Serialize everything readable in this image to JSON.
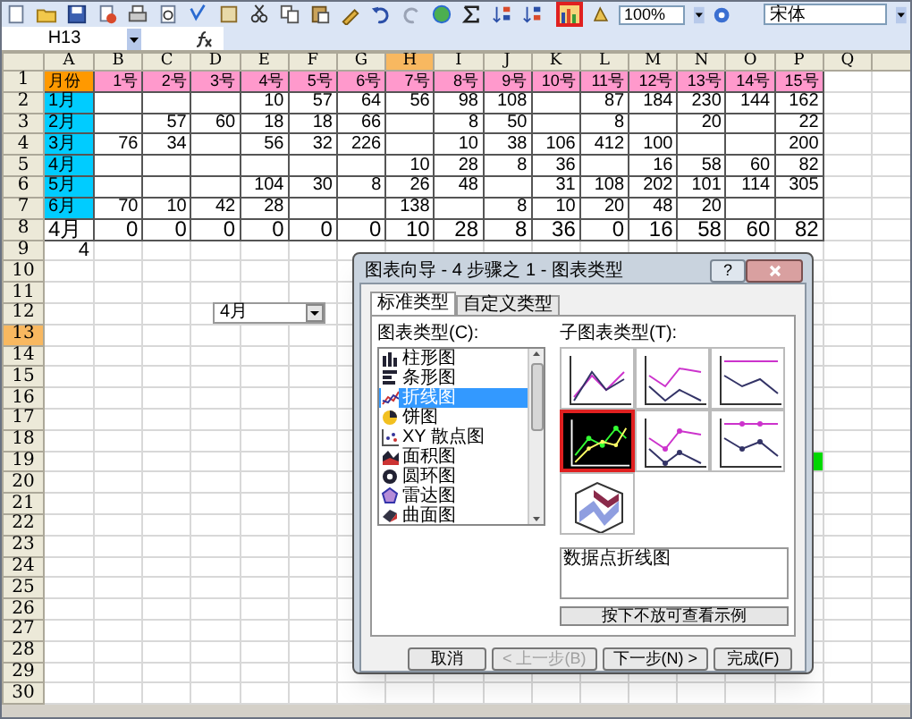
{
  "toolbar": {
    "chart_wizard": {
      "highlighted": true
    },
    "zoom": "100%",
    "font": "宋体"
  },
  "name_box": "H13",
  "sheet": {
    "columns": [
      {
        "label": "A",
        "selected": false
      },
      {
        "label": "B",
        "selected": false
      },
      {
        "label": "C",
        "selected": false
      },
      {
        "label": "D",
        "selected": false
      },
      {
        "label": "E",
        "selected": false
      },
      {
        "label": "F",
        "selected": false
      },
      {
        "label": "G",
        "selected": false
      },
      {
        "label": "H",
        "selected": true
      },
      {
        "label": "I",
        "selected": false
      },
      {
        "label": "J",
        "selected": false
      },
      {
        "label": "K",
        "selected": false
      },
      {
        "label": "L",
        "selected": false
      },
      {
        "label": "M",
        "selected": false
      },
      {
        "label": "N",
        "selected": false
      },
      {
        "label": "O",
        "selected": false
      },
      {
        "label": "P",
        "selected": false
      },
      {
        "label": "Q",
        "selected": false
      }
    ],
    "rows": [
      {
        "number": "1",
        "selected": false,
        "kind": "header",
        "cells": [
          {
            "text": "月份",
            "color": "#ff9900"
          },
          {
            "text": "1号",
            "color": "#ff99cc"
          },
          {
            "text": "2号",
            "color": "#ff99cc"
          },
          {
            "text": "3号",
            "color": "#ff99cc"
          },
          {
            "text": "4号",
            "color": "#ff99cc"
          },
          {
            "text": "5号",
            "color": "#ff99cc"
          },
          {
            "text": "6号",
            "color": "#ff99cc"
          },
          {
            "text": "7号",
            "color": "#ff99cc"
          },
          {
            "text": "8号",
            "color": "#ff99cc"
          },
          {
            "text": "9号",
            "color": "#ff99cc"
          },
          {
            "text": "10号",
            "color": "#ff99cc"
          },
          {
            "text": "11号",
            "color": "#ff99cc"
          },
          {
            "text": "12号",
            "color": "#ff99cc"
          },
          {
            "text": "13号",
            "color": "#ff99cc"
          },
          {
            "text": "14号",
            "color": "#ff99cc"
          },
          {
            "text": "15号",
            "color": "#ff99cc"
          }
        ]
      },
      {
        "number": "2",
        "selected": false,
        "kind": "data",
        "cells": [
          {
            "text": "1月",
            "color": "#00ccff"
          },
          null,
          null,
          null,
          "10",
          "57",
          "64",
          "56",
          "98",
          "108",
          null,
          "87",
          "184",
          "230",
          "144",
          "162"
        ]
      },
      {
        "number": "3",
        "selected": false,
        "kind": "data",
        "cells": [
          {
            "text": "2月",
            "color": "#00ccff"
          },
          null,
          "57",
          "60",
          "18",
          "18",
          "66",
          null,
          "8",
          "50",
          null,
          "8",
          null,
          "20",
          null,
          "22"
        ]
      },
      {
        "number": "4",
        "selected": false,
        "kind": "data",
        "cells": [
          {
            "text": "3月",
            "color": "#00ccff"
          },
          "76",
          "34",
          null,
          "56",
          "32",
          "226",
          null,
          "10",
          "38",
          "106",
          "412",
          "100",
          null,
          null,
          "200"
        ]
      },
      {
        "number": "5",
        "selected": false,
        "kind": "data",
        "cells": [
          {
            "text": "4月",
            "color": "#00ccff"
          },
          null,
          null,
          null,
          null,
          null,
          null,
          "10",
          "28",
          "8",
          "36",
          null,
          "16",
          "58",
          "60",
          "82"
        ]
      },
      {
        "number": "6",
        "selected": false,
        "kind": "data",
        "cells": [
          {
            "text": "5月",
            "color": "#00ccff"
          },
          null,
          null,
          null,
          "104",
          "30",
          "8",
          "26",
          "48",
          null,
          "31",
          "108",
          "202",
          "101",
          "114",
          "305"
        ]
      },
      {
        "number": "7",
        "selected": false,
        "kind": "data",
        "cells": [
          {
            "text": "6月",
            "color": "#00ccff"
          },
          "70",
          "10",
          "42",
          "28",
          null,
          null,
          "138",
          null,
          "8",
          "10",
          "20",
          "48",
          "20"
        ]
      },
      {
        "number": "8",
        "selected": false,
        "kind": "total",
        "cells": [
          "4月",
          "0",
          "0",
          "0",
          "0",
          "0",
          "0",
          "10",
          "28",
          "8",
          "36",
          "0",
          "16",
          "58",
          "60",
          "82"
        ]
      },
      {
        "number": "9",
        "selected": false,
        "kind": "value",
        "cells": [
          "4"
        ]
      },
      {
        "number": "10",
        "selected": false,
        "kind": "blank"
      },
      {
        "number": "11",
        "selected": false,
        "kind": "blank"
      },
      {
        "number": "12",
        "selected": false,
        "kind": "blank"
      },
      {
        "number": "13",
        "selected": true,
        "kind": "blank"
      },
      {
        "number": "14",
        "selected": false,
        "kind": "blank"
      },
      {
        "number": "15",
        "selected": false,
        "kind": "blank"
      },
      {
        "number": "16",
        "selected": false,
        "kind": "blank"
      },
      {
        "number": "17",
        "selected": false,
        "kind": "blank"
      },
      {
        "number": "18",
        "selected": false,
        "kind": "blank"
      },
      {
        "number": "19",
        "selected": false,
        "kind": "blank",
        "cells": [
          null,
          null,
          null,
          null,
          null,
          null,
          null,
          null,
          null,
          null,
          null,
          null,
          null,
          null,
          null,
          {
            "color": "#00dd00"
          }
        ]
      },
      {
        "number": "20",
        "selected": false,
        "kind": "blank"
      },
      {
        "number": "21",
        "selected": false,
        "kind": "blank"
      },
      {
        "number": "22",
        "selected": false,
        "kind": "blank"
      },
      {
        "number": "23",
        "selected": false,
        "kind": "blank"
      },
      {
        "number": "24",
        "selected": false,
        "kind": "blank"
      },
      {
        "number": "25",
        "selected": false,
        "kind": "blank"
      },
      {
        "number": "26",
        "selected": false,
        "kind": "blank"
      },
      {
        "number": "27",
        "selected": false,
        "kind": "blank"
      },
      {
        "number": "28",
        "selected": false,
        "kind": "blank"
      },
      {
        "number": "29",
        "selected": false,
        "kind": "blank"
      },
      {
        "number": "30",
        "selected": false,
        "kind": "blank"
      }
    ]
  },
  "combo_box": {
    "value": "4月"
  },
  "dialog": {
    "title": "图表向导 - 4 步骤之 1 - 图表类型",
    "help": "?",
    "tabs": [
      {
        "label": "标准类型",
        "selected": true
      },
      {
        "label": "自定义类型",
        "selected": false
      }
    ],
    "chart_type_label": "图表类型(C):",
    "chart_types": [
      {
        "label": "柱形图",
        "kind": "column",
        "selected": false
      },
      {
        "label": "条形图",
        "kind": "bar",
        "selected": false
      },
      {
        "label": "折线图",
        "kind": "line",
        "selected": true
      },
      {
        "label": "饼图",
        "kind": "pie",
        "selected": false
      },
      {
        "label": "XY 散点图",
        "kind": "scatter",
        "selected": false
      },
      {
        "label": "面积图",
        "kind": "area",
        "selected": false
      },
      {
        "label": "圆环图",
        "kind": "doughnut",
        "selected": false
      },
      {
        "label": "雷达图",
        "kind": "radar",
        "selected": false
      },
      {
        "label": "曲面图",
        "kind": "surface",
        "selected": false
      }
    ],
    "subtype_label": "子图表类型(T):",
    "subtypes": [
      {
        "kind": "line",
        "selected": false,
        "highlighted": false
      },
      {
        "kind": "stacked",
        "selected": false,
        "highlighted": false
      },
      {
        "kind": "percent",
        "selected": false,
        "highlighted": false
      },
      {
        "kind": "line-markers",
        "selected": true,
        "highlighted": true
      },
      {
        "kind": "stacked-markers",
        "selected": false,
        "highlighted": false
      },
      {
        "kind": "percent-markers",
        "selected": false,
        "highlighted": false
      },
      {
        "kind": "perspective",
        "selected": false,
        "highlighted": false
      }
    ],
    "description": "数据点折线图",
    "preview_button": "按下不放可查看示例",
    "buttons": [
      {
        "label": "取消",
        "disabled": false
      },
      {
        "label": "< 上一步(B)",
        "disabled": true
      },
      {
        "label": "下一步(N) >",
        "disabled": false
      },
      {
        "label": "完成(F)",
        "disabled": false
      }
    ]
  }
}
